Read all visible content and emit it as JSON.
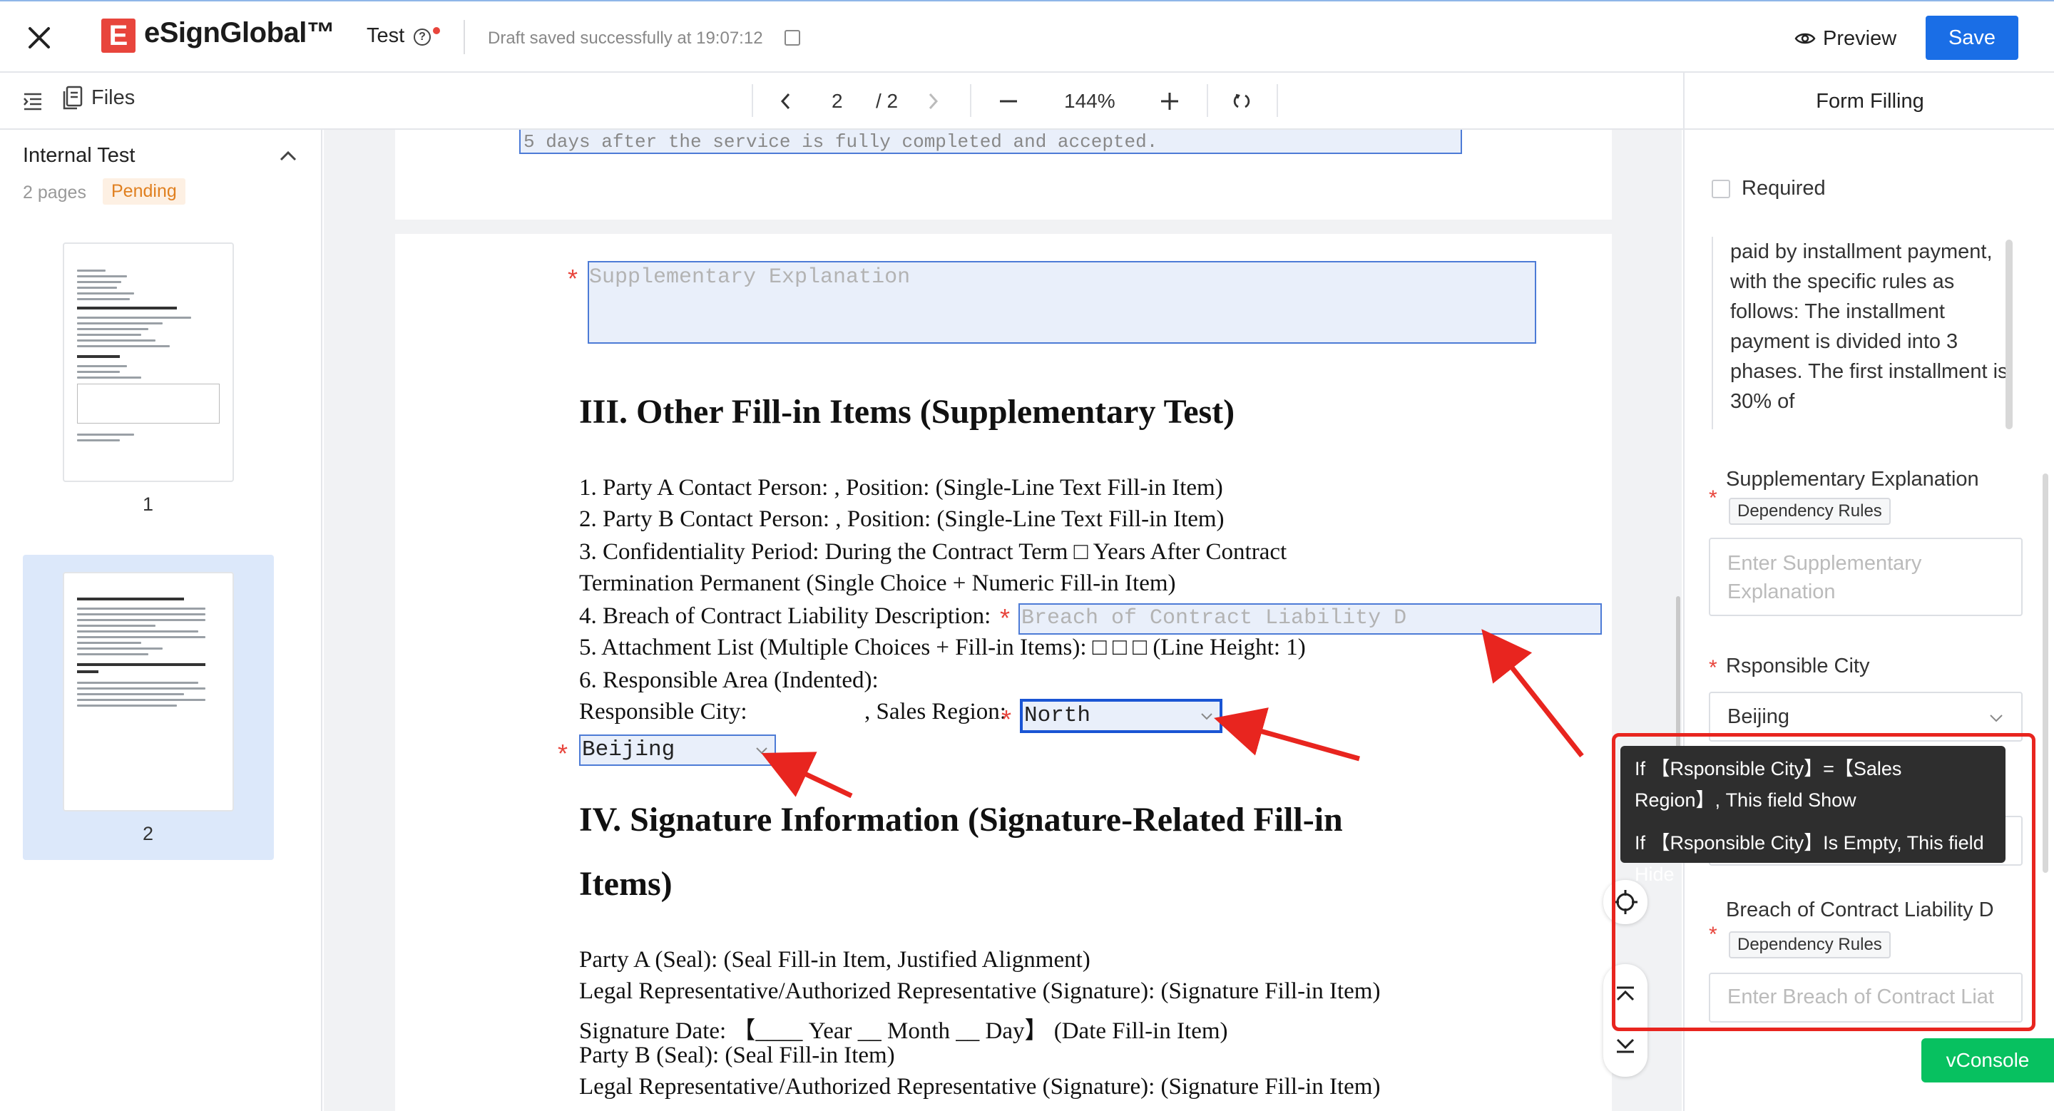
{
  "app": {
    "brand_mark": "E",
    "brand_name": "eSignGlobal™",
    "doc_title": "Test",
    "help_symbol": "?",
    "draft_status": "Draft saved successfully at 19:07:12",
    "preview_label": "Preview",
    "save_label": "Save"
  },
  "toolbar": {
    "files_label": "Files",
    "page_current": "2",
    "page_total": "/ 2",
    "zoom": "144%"
  },
  "left_panel": {
    "group_title": "Internal Test",
    "pages_count": "2 pages",
    "status_badge": "Pending",
    "thumbnails": [
      {
        "label": "1"
      },
      {
        "label": "2"
      }
    ]
  },
  "document": {
    "cut_off_line": "5 days after the service is fully completed and accepted.",
    "supplementary_placeholder": "Supplementary Explanation",
    "heading_3": "III. Other Fill-in Items (Supplementary Test)",
    "lines": [
      "1. Party A Contact Person: , Position: (Single-Line Text Fill-in Item)",
      "2. Party B Contact Person: , Position: (Single-Line Text Fill-in Item)",
      "3. Confidentiality Period:    During the Contract Term □ Years After Contract",
      "Termination      Permanent (Single Choice + Numeric Fill-in Item)",
      "4. Breach of Contract Liability Description:",
      "5. Attachment List (Multiple Choices + Fill-in Items): □ □ □ (Line Height: 1)",
      "6. Responsible Area (Indented):",
      "Responsible City:",
      ", Sales Region:"
    ],
    "breach_placeholder": "Breach of Contract Liability D",
    "sales_region_value": "North",
    "city_value": "Beijing",
    "heading_4_line1": "IV. Signature Information (Signature-Related Fill-in",
    "heading_4_line2": "Items)",
    "sig_lines": [
      "Party A (Seal): (Seal Fill-in Item, Justified Alignment)",
      "Legal Representative/Authorized Representative (Signature): (Signature Fill-in Item)",
      "Signature Date: 【____ Year __ Month __ Day】 (Date Fill-in Item)",
      "Party B (Seal): (Seal Fill-in Item)",
      "Legal Representative/Authorized Representative (Signature): (Signature Fill-in Item)"
    ]
  },
  "right_panel": {
    "title": "Form Filling",
    "required_label": "Required",
    "text_block": "paid by installment payment, with the specific rules as follows: The installment payment is divided into 3 phases. The first installment is 30% of",
    "supp_label": "Supplementary Explanation",
    "dependency_tag": "Dependency Rules",
    "supp_placeholder": "Enter Supplementary Explanation",
    "city_label": "Rsponsible City",
    "city_value": "Beijing",
    "breach_label": "Breach of Contract Liability D",
    "breach_placeholder": "Enter Breach of Contract Liat"
  },
  "tooltip": {
    "rule1": "If 【Rsponsible City】=【Sales Region】, This field Show",
    "rule2": "If 【Rsponsible City】Is Empty, This field Hide"
  },
  "vconsole_label": "vConsole",
  "colors": {
    "brand_red": "#e8453c",
    "primary_blue": "#1a6ee6",
    "annotation_red": "#e8251f",
    "vconsole_green": "#07c160"
  }
}
